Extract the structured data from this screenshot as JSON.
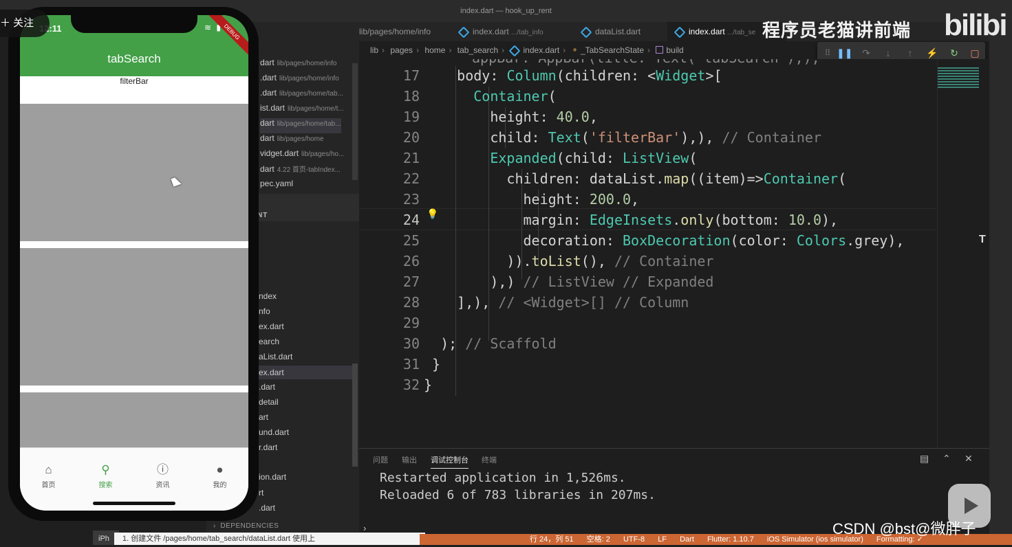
{
  "window": {
    "title": "index.dart — hook_up_rent"
  },
  "explorer": {
    "open_editors": [
      {
        "name": "dart",
        "hint": "lib/pages/home/info"
      },
      {
        "name": ".dart",
        "hint": "lib/pages/home/info"
      },
      {
        "name": ".dart",
        "hint": "lib/pages/home/tab..."
      },
      {
        "name": "ist.dart",
        "hint": "lib/pages/home/t..."
      },
      {
        "name": "dart",
        "hint": "lib/pages/home/tab..."
      },
      {
        "name": "dart",
        "hint": "lib/pages/home"
      },
      {
        "name": "vidget.dart",
        "hint": "lib/pages/ho..."
      },
      {
        "name": "dart",
        "hint": "4.22 首页-tabIndex..."
      },
      {
        "name": "pec.yaml",
        "hint": ""
      }
    ],
    "section_label": "NT",
    "tree_items": [
      "ndex",
      "nfo",
      "ex.dart",
      "earch",
      "aList.dart",
      "ex.dart",
      ".dart",
      "detail",
      "art",
      "und.dart",
      "r.dart",
      "ion.dart",
      "rt",
      ".dart"
    ],
    "dependencies_label": "DEPENDENCIES"
  },
  "tabs": [
    {
      "label": "lib/pages/home/info",
      "dim": ""
    },
    {
      "label": "index.dart",
      "dim": ".../tab_info"
    },
    {
      "label": "dataList.dart",
      "dim": ""
    },
    {
      "label": "index.dart",
      "dim": ".../tab_se"
    }
  ],
  "breadcrumb": [
    "lib",
    "pages",
    "home",
    "tab_search",
    "index.dart",
    "_TabSearchState",
    "build"
  ],
  "debug_toolbar": {
    "icons": [
      "drag-handle-icon",
      "pause-icon",
      "step-over-icon",
      "step-into-icon",
      "step-out-icon",
      "hot-reload-icon",
      "restart-icon",
      "stop-icon"
    ]
  },
  "editor": {
    "line_numbers": [
      "17",
      "18",
      "19",
      "20",
      "21",
      "22",
      "23",
      "24",
      "25",
      "26",
      "27",
      "28",
      "29",
      "30",
      "31",
      "32"
    ],
    "top_partial": "appBar: AppBar(title: Text('tabSearch'),),",
    "current_line": "24",
    "minimap_marker": "T"
  },
  "panel": {
    "tabs": [
      "问题",
      "输出",
      "调试控制台",
      "终端"
    ],
    "active_tab": "调试控制台",
    "output": [
      "Restarted application in 1,526ms.",
      "Reloaded 6 of 783 libraries in 207ms."
    ]
  },
  "statusbar": {
    "items": [
      "行 24，列 51",
      "空格: 2",
      "UTF-8",
      "LF",
      "Dart",
      "Flutter: 1.10.7",
      "iOS Simulator (ios simulator)",
      "Formatting: ✓"
    ]
  },
  "notification": {
    "text": "1. 创建文件 /pages/home/tab_search/dataList.dart 使用上",
    "device_label": "iPh"
  },
  "phone": {
    "clock": "12:11",
    "debug_ribbon": "DEBUG",
    "app_title": "tabSearch",
    "filter_bar": "filterBar",
    "item_count": 3,
    "nav": [
      {
        "label": "首页",
        "icon": "home-icon",
        "active": false
      },
      {
        "label": "搜索",
        "icon": "search-icon",
        "active": true
      },
      {
        "label": "资讯",
        "icon": "info-icon",
        "active": false
      },
      {
        "label": "我的",
        "icon": "account-icon",
        "active": false
      }
    ],
    "colors": {
      "app_bar": "#43a047",
      "list_item": "#9e9e9e"
    }
  },
  "overlay": {
    "follow_label": "＋ 关注",
    "watermark_text": "程序员老猫讲前端",
    "bili_logo": "bilibi",
    "csdn": "CSDN @bst@微胖子"
  }
}
